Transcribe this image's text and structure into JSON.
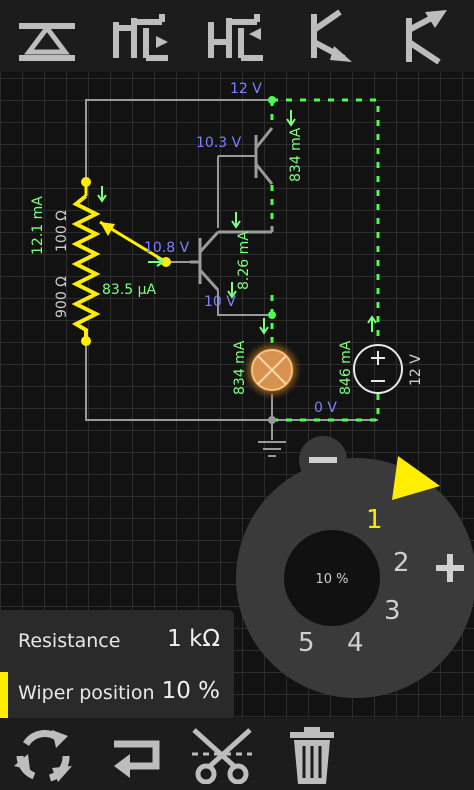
{
  "toolbar_top": {
    "tools": [
      {
        "name": "diode-tool",
        "icon": "diode-icon"
      },
      {
        "name": "n-mosfet-tool",
        "icon": "n-mosfet-icon"
      },
      {
        "name": "p-mosfet-tool",
        "icon": "p-mosfet-icon"
      },
      {
        "name": "npn-transistor-tool",
        "icon": "npn-transistor-icon"
      },
      {
        "name": "pnp-transistor-tool",
        "icon": "pnp-transistor-icon"
      }
    ]
  },
  "circuit": {
    "labels": {
      "v_12_top": "12 V",
      "v_10_3": "10.3 V",
      "i_834_top": "834 mA",
      "i_12_1": "12.1 mA",
      "r_100": "100 Ω",
      "r_900": "900 Ω",
      "v_10_8": "10.8 V",
      "i_8_26": "8.26 mA",
      "i_83_5": "83.5 µA",
      "v_10": "10 V",
      "i_834_lamp": "834 mA",
      "i_846": "846 mA",
      "v_12_source": "12 V",
      "v_0": "0 V"
    }
  },
  "dial": {
    "center_label": "10 %",
    "numbers": [
      "1",
      "2",
      "3",
      "4",
      "5"
    ],
    "selected": "1",
    "minus_label": "−",
    "plus_label": "+"
  },
  "properties": {
    "resistance_label": "Resistance",
    "resistance_value": "1 kΩ",
    "wiper_label": "Wiper position",
    "wiper_value": "10 %"
  },
  "toolbar_bottom": {
    "tools": [
      {
        "name": "rotate-button",
        "icon": "rotate-arrows-icon"
      },
      {
        "name": "flip-button",
        "icon": "flip-arrows-icon"
      },
      {
        "name": "cut-button",
        "icon": "scissors-icon"
      },
      {
        "name": "delete-button",
        "icon": "trash-icon"
      }
    ]
  },
  "colors": {
    "wire": "#9a9a9a",
    "active_wire": "#4cff4c",
    "current_text": "#7dff7d",
    "voltage_text": "#7d7dff",
    "resistor": "#ffee00",
    "accent": "#ffee00",
    "dial_ring": "#3a3a3a"
  }
}
